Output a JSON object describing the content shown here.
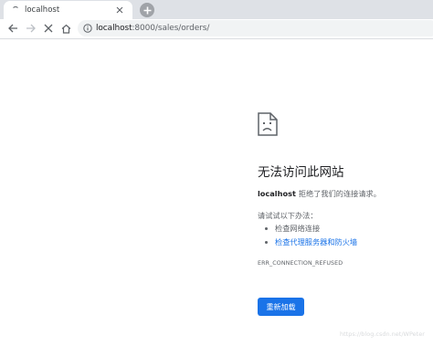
{
  "browser": {
    "tab": {
      "title": "localhost"
    },
    "address": {
      "host": "localhost",
      "path": ":8000/sales/orders/"
    },
    "icons": {
      "back": "arrow-left-icon",
      "forward": "arrow-right-icon",
      "stop": "x-icon",
      "home": "home-icon",
      "site_info": "info-circle-icon",
      "new_tab": "plus-icon",
      "tab_close": "x-icon"
    }
  },
  "error_page": {
    "icon": "sad-document-icon",
    "title": "无法访问此网站",
    "host": "localhost",
    "description": "拒绝了我们的连接请求。",
    "try_title": "请试试以下办法：",
    "suggestions": [
      "检查网络连接",
      "检查代理服务器和防火墙"
    ],
    "error_code": "ERR_CONNECTION_REFUSED",
    "reload_label": "重新加载",
    "accent_color": "#1a73e8"
  },
  "watermark": "https://blog.csdn.net/WPeter"
}
